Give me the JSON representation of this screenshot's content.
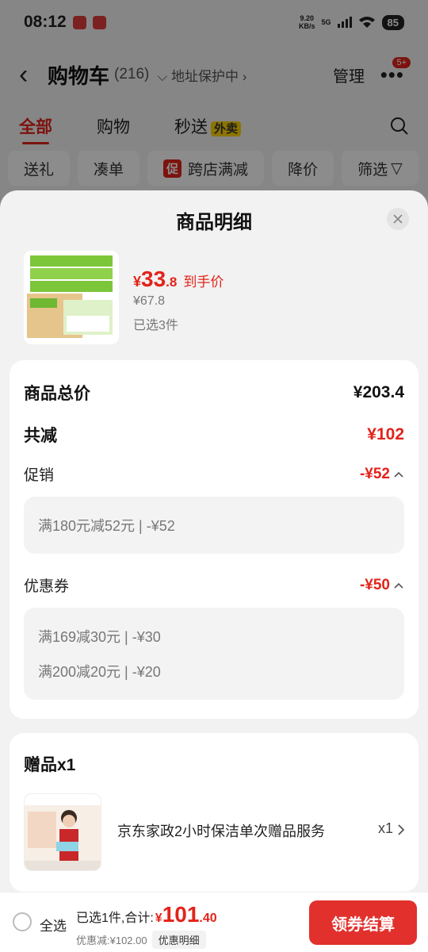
{
  "status_bar": {
    "time": "08:12",
    "net_speed_top": "9.20",
    "net_speed_bottom": "KB/s",
    "network": "5G",
    "battery": "85"
  },
  "nav": {
    "title": "购物车",
    "count": "(216)",
    "address_protect": "地址保护中",
    "manage": "管理",
    "msg_badge": "5+"
  },
  "tabs": [
    {
      "label": "全部",
      "active": true
    },
    {
      "label": "购物"
    },
    {
      "label": "秒送",
      "tag": "外卖"
    }
  ],
  "filters": {
    "gift": "送礼",
    "bundle": "凑单",
    "promo_mark": "促",
    "cross_store": "跨店满减",
    "price_drop": "降价",
    "filter": "筛选"
  },
  "sheet": {
    "title": "商品明细",
    "product": {
      "price_symbol": "¥",
      "price_int": "33",
      "price_dec": ".8",
      "price_tag": "到手价",
      "original_price": "¥67.8",
      "selected_count": "已选3件"
    },
    "summary": {
      "total_label": "商品总价",
      "total_value": "¥203.4",
      "reduce_label": "共减",
      "reduce_value": "¥102",
      "promo_label": "促销",
      "promo_value": "-¥52",
      "promo_items": [
        "满180元减52元 | -¥52"
      ],
      "coupon_label": "优惠券",
      "coupon_value": "-¥50",
      "coupon_items": [
        "满169减30元 | -¥30",
        "满200减20元 | -¥20"
      ]
    },
    "gift": {
      "title": "赠品x1",
      "name": "京东家政2小时保洁单次赠品服务",
      "qty": "x1"
    }
  },
  "bottom_bar": {
    "select_all": "全选",
    "total_label": "已选1件,合计:",
    "total_symbol": "¥",
    "total_int": "101",
    "total_dec": ".40",
    "discount_text": "优惠减:¥102.00",
    "detail_link": "优惠明细",
    "checkout": "领券结算"
  },
  "colors": {
    "accent_red": "#e2231a",
    "tag_yellow": "#ffd400"
  }
}
